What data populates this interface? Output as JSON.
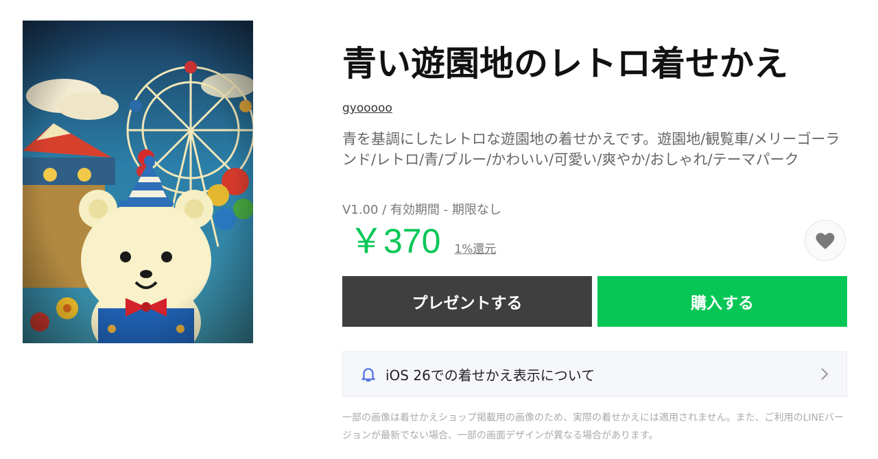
{
  "product": {
    "image_alt": "青い遊園地のレトロ着せかえ",
    "title": "青い遊園地のレトロ着せかえ",
    "author": "gyooooo",
    "description": "青を基調にしたレトロな遊園地の着せかえです。遊園地/観覧車/メリーゴーランド/レトロ/青/ブルー/かわいい/可愛い/爽やか/おしゃれ/テーマパーク",
    "version": "V1.00 / 有効期間 - 期限なし",
    "price": "￥370",
    "cashback": "1%還元"
  },
  "actions": {
    "gift_label": "プレゼントする",
    "buy_label": "購入する",
    "favorite_icon": "heart-icon"
  },
  "notice": {
    "icon": "bell-icon",
    "text": "iOS 26での着せかえ表示について",
    "chevron": "chevron-right-icon"
  },
  "disclaimer": "一部の画像は着せかえショップ掲載用の画像のため、実際の着せかえには適用されません。また、ご利用のLINEバージョンが最新でない場合、一部の画面デザインが異なる場合があります。",
  "colors": {
    "accent_green": "#06c755",
    "gift_button": "#3f3f3f"
  }
}
